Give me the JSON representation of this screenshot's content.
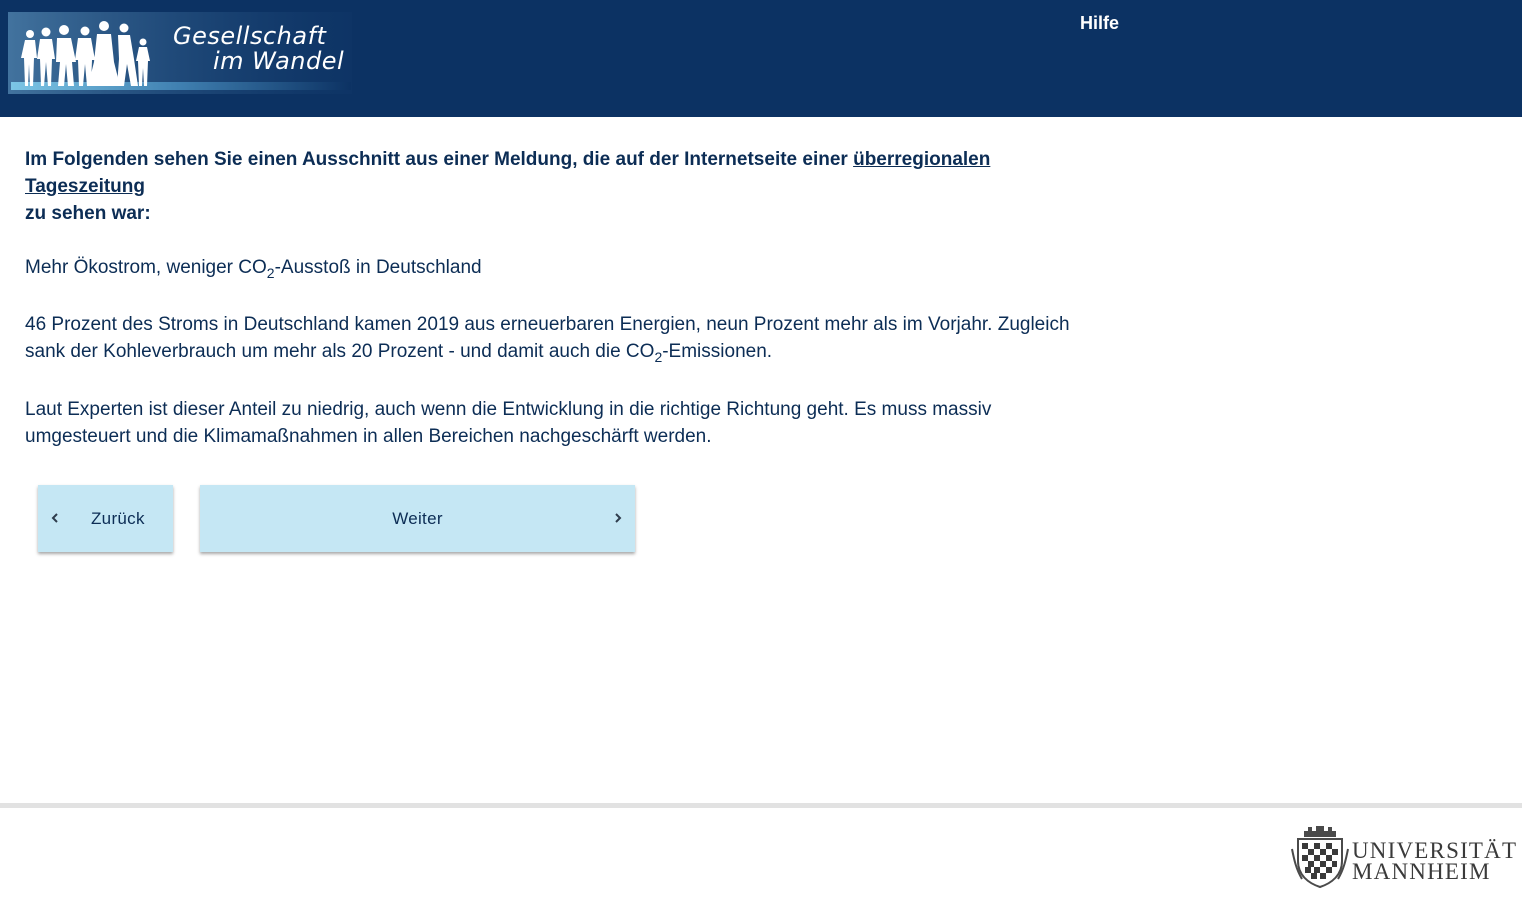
{
  "header": {
    "logo_line1": "Gesellschaft",
    "logo_line2": "im Wandel",
    "help_label": "Hilfe",
    "background_color": "#0c3263"
  },
  "content": {
    "intro_text": "Im Folgenden sehen Sie einen Ausschnitt aus einer Meldung, die auf der Internetseite einer ",
    "intro_link": "überregionalen Tageszeitung",
    "intro_text_end": "zu sehen war:",
    "headline_pre": "Mehr Ökostrom, weniger CO",
    "headline_sub": "2",
    "headline_post": "-Ausstoß in Deutschland",
    "para1_line1": "46 Prozent des Stroms in Deutschland kamen 2019 aus erneuerbaren Energien, neun Prozent mehr als im Vorjahr. Zugleich",
    "para1_line2_pre": "sank der Kohleverbrauch um mehr als 20 Prozent - und damit auch die CO",
    "para1_sub": "2",
    "para1_line2_post": "-Emissionen.",
    "para2_line1": "Laut Experten ist dieser Anteil zu niedrig, auch wenn die Entwicklung in die richtige Richtung geht. Es muss massiv",
    "para2_line2": "umgesteuert und die Klimamaßnahmen in allen Bereichen nachgeschärft werden."
  },
  "navigation": {
    "back_label": "Zurück",
    "next_label": "Weiter",
    "button_color": "#c5e7f4"
  },
  "footer": {
    "logo_line1": "UNIVERSITÄT",
    "logo_line2": "MANNHEIM"
  },
  "icons": {
    "back": "chevron-left-icon",
    "next": "chevron-right-icon"
  }
}
